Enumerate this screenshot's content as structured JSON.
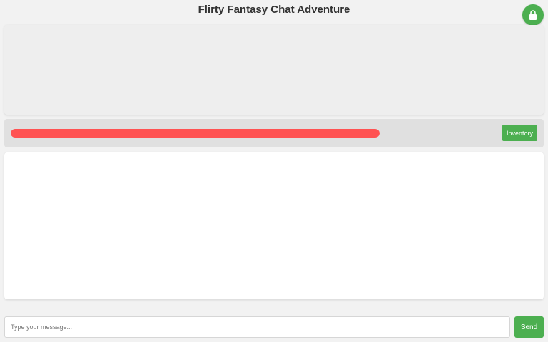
{
  "header": {
    "title": "Flirty Fantasy Chat Adventure",
    "menu_icon": "lock-icon"
  },
  "status": {
    "health_fraction": 1.0,
    "bar_color": "#ff5252",
    "inventory_label": "Inventory"
  },
  "composer": {
    "placeholder": "Type your message...",
    "value": "",
    "send_label": "Send"
  },
  "colors": {
    "accent": "#4caf50",
    "background": "#f2f2f2"
  }
}
